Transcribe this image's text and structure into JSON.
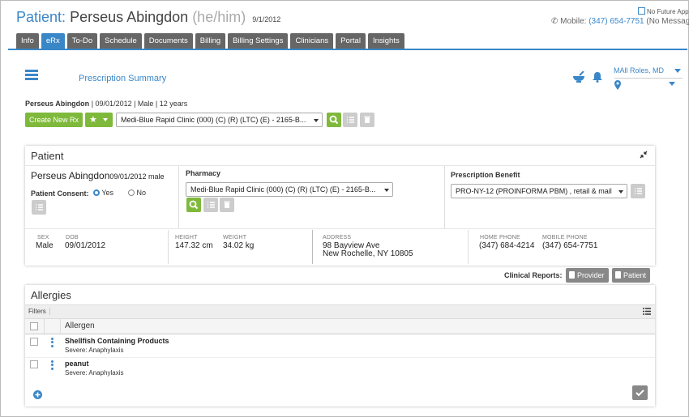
{
  "header": {
    "title_label": "Patient:",
    "patient_name": "Perseus Abingdon",
    "pronouns": "(he/him)",
    "date": "9/1/2012",
    "no_future": "No Future App",
    "mobile_label": "Mobile:",
    "mobile_number": "(347) 654-7751",
    "mobile_note": "(No Messages"
  },
  "tabs": [
    "Info",
    "eRx",
    "To-Do",
    "Schedule",
    "Documents",
    "Billing",
    "Billing Settings",
    "Clinicians",
    "Portal",
    "Insights"
  ],
  "toolbar": {
    "summary_title": "Prescription Summary",
    "user_role": "MAll Roles, MD"
  },
  "patient_line": {
    "name": "Perseus Abingdon",
    "details": "| 09/01/2012 | Male | 12 years"
  },
  "create_button": "Create New Rx",
  "pharmacy_select_top": "Medi-Blue Rapid Clinic (000) (C) (R) (LTC) (E) - 2165-B...",
  "patient_panel": {
    "title": "Patient",
    "name": "Perseus Abingdon",
    "dob_sex": "09/01/2012 male",
    "consent_label": "Patient Consent:",
    "consent_yes": "Yes",
    "consent_no": "No",
    "pharmacy_label": "Pharmacy",
    "pharmacy_value": "Medi-Blue Rapid Clinic (000) (C) (R) (LTC) (E) - 2165-B...",
    "benefit_label": "Prescription Benefit",
    "benefit_value": "PRO-NY-12 (PROINFORMA PBM) , retail & mail",
    "sex_label": "SEX",
    "sex": "Male",
    "dob_label": "DOB",
    "dob": "09/01/2012",
    "height_label": "HEIGHT",
    "height": "147.32 cm",
    "weight_label": "WEIGHT",
    "weight": "34.02 kg",
    "address_label": "ADDRESS",
    "address1": "98 Bayview Ave",
    "address2": "New Rochelle, NY 10805",
    "home_label": "HOME PHONE",
    "home": "(347) 684-4214",
    "mobile_label": "MOBILE PHONE",
    "mobile": "(347) 654-7751"
  },
  "clinical_reports": {
    "label": "Clinical Reports:",
    "provider": "Provider",
    "patient": "Patient"
  },
  "allergies": {
    "title": "Allergies",
    "filters": "Filters",
    "column": "Allergen",
    "rows": [
      {
        "name": "Shellfish Containing Products",
        "severity": "Severe: Anaphylaxis"
      },
      {
        "name": "peanut",
        "severity": "Severe: Anaphylaxis"
      }
    ]
  },
  "colors": {
    "accent": "#3a87c8",
    "green": "#7fb93b",
    "tab": "#666666"
  }
}
